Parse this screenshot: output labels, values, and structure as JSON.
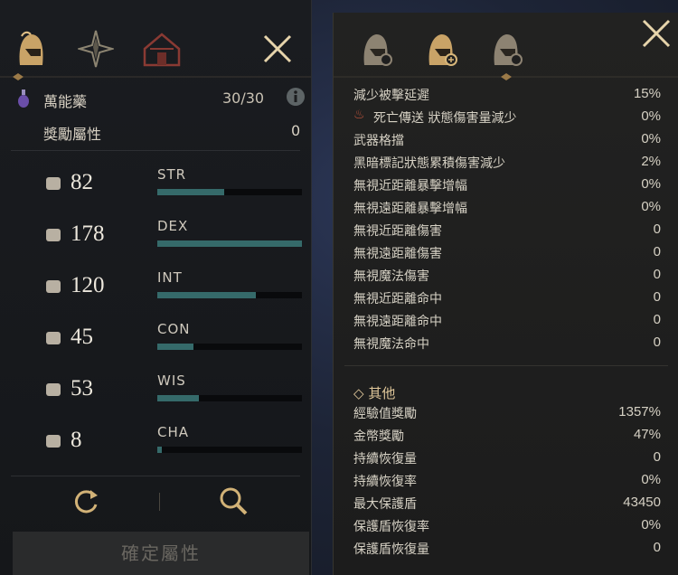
{
  "left_panel": {
    "potion": {
      "name": "萬能藥",
      "count": "30/30",
      "info_icon": "info-icon"
    },
    "bonus": {
      "label": "獎勵屬性",
      "value": "0"
    },
    "stats": [
      {
        "value": "82",
        "label": "STR",
        "fill": 0.46,
        "icon": "strength-arm-icon"
      },
      {
        "value": "178",
        "label": "DEX",
        "fill": 1.0,
        "icon": "dexterity-boot-icon"
      },
      {
        "value": "120",
        "label": "INT",
        "fill": 0.68,
        "icon": "intelligence-book-icon"
      },
      {
        "value": "45",
        "label": "CON",
        "fill": 0.25,
        "icon": "constitution-heart-icon"
      },
      {
        "value": "53",
        "label": "WIS",
        "fill": 0.29,
        "icon": "wisdom-head-icon"
      },
      {
        "value": "8",
        "label": "CHA",
        "fill": 0.03,
        "icon": "charisma-crown-icon"
      }
    ],
    "confirm_label": "確定屬性"
  },
  "right_panel": {
    "rows": [
      {
        "key": "減少被擊延遲",
        "value": "15%"
      },
      {
        "key": "死亡傳送 狀態傷害量減少",
        "value": "0%"
      },
      {
        "key": "武器格擋",
        "value": "0%"
      },
      {
        "key": "黑暗標記狀態累積傷害減少",
        "value": "2%"
      },
      {
        "key": "無視近距離暴擊增幅",
        "value": "0%"
      },
      {
        "key": "無視遠距離暴擊增幅",
        "value": "0%"
      },
      {
        "key": "無視近距離傷害",
        "value": "0"
      },
      {
        "key": "無視遠距離傷害",
        "value": "0"
      },
      {
        "key": "無視魔法傷害",
        "value": "0"
      },
      {
        "key": "無視近距離命中",
        "value": "0"
      },
      {
        "key": "無視遠距離命中",
        "value": "0"
      },
      {
        "key": "無視魔法命中",
        "value": "0"
      }
    ],
    "other_title": "其他",
    "other_rows": [
      {
        "key": "經驗值獎勵",
        "value": "1357%"
      },
      {
        "key": "金幣獎勵",
        "value": "47%"
      },
      {
        "key": "持續恢復量",
        "value": "0"
      },
      {
        "key": "持續恢復率",
        "value": "0%"
      },
      {
        "key": "最大保護盾",
        "value": "43450"
      },
      {
        "key": "保護盾恢復率",
        "value": "0%"
      },
      {
        "key": "保護盾恢復量",
        "value": "0"
      }
    ]
  },
  "colors": {
    "accent_gold": "#d8b77a",
    "bar_teal": "#356a6a",
    "text": "#d8d1c3"
  }
}
